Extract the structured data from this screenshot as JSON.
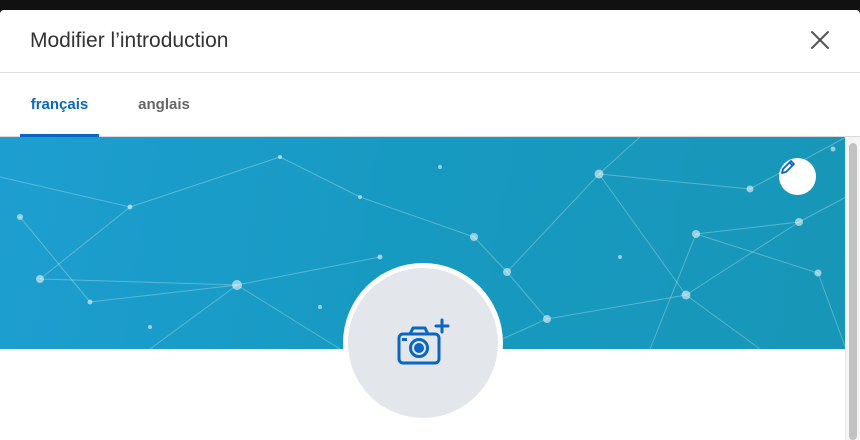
{
  "dialog": {
    "title": "Modifier l’introduction",
    "close_icon": "close-icon"
  },
  "tabs": [
    {
      "label": "français",
      "active": true
    },
    {
      "label": "anglais",
      "active": false
    }
  ],
  "banner": {
    "edit_icon": "pencil-icon",
    "colors": {
      "start": "#1d9ed0",
      "end": "#1796b7"
    }
  },
  "profile_photo": {
    "icon": "camera-add-icon"
  },
  "colors": {
    "accent": "#0a66c2",
    "avatar_bg": "#e3e6ea"
  }
}
